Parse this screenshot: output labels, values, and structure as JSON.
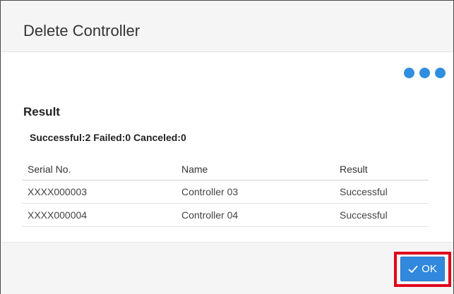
{
  "dialog": {
    "title": "Delete Controller"
  },
  "progress": {
    "icon": "loading-dots-icon",
    "color": "#2f8ee0"
  },
  "result": {
    "heading": "Result",
    "summary": "Successful:2 Failed:0 Canceled:0",
    "columns": {
      "serial": "Serial No.",
      "name": "Name",
      "result": "Result"
    },
    "rows": [
      {
        "serial": "XXXX000003",
        "name": "Controller 03",
        "result": "Successful"
      },
      {
        "serial": "XXXX000004",
        "name": "Controller 04",
        "result": "Successful"
      }
    ]
  },
  "footer": {
    "ok_label": "OK",
    "ok_icon": "check-icon",
    "ok_color": "#3188dc",
    "highlight_color": "#e0061c"
  }
}
